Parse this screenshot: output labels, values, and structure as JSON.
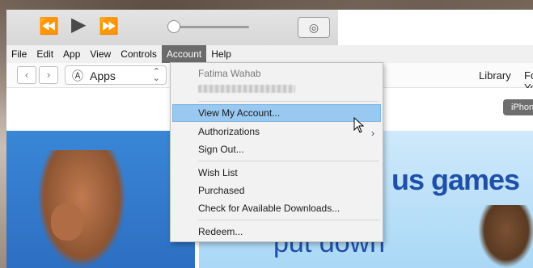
{
  "menubar": {
    "items": [
      "File",
      "Edit",
      "App",
      "View",
      "Controls",
      "Account",
      "Help"
    ],
    "active": "Account"
  },
  "toolbar": {
    "back_glyph": "‹",
    "forward_glyph": "›",
    "media_select_label": "Apps",
    "nav_library": "Library",
    "nav_for_you": "For You"
  },
  "content": {
    "chip_label": "iPhone",
    "banner_title": "us games",
    "banner_subtitle": "put down"
  },
  "account_menu": {
    "user_name": "Fatima Wahab",
    "items": [
      {
        "label": "View My Account...",
        "highlighted": true
      },
      {
        "label": "Authorizations",
        "submenu": true
      },
      {
        "label": "Sign Out..."
      },
      {
        "label": "Wish List"
      },
      {
        "label": "Purchased"
      },
      {
        "label": "Check for Available Downloads..."
      },
      {
        "label": "Redeem..."
      }
    ]
  },
  "icons": {
    "rewind": "rewind-icon",
    "play": "play-icon",
    "fast_forward": "fast-forward-icon",
    "airplay": "airplay-icon",
    "apps": "apps-icon",
    "submenu": "chevron-right-icon",
    "cursor": "mouse-cursor-icon"
  },
  "colors": {
    "menu_active_bg": "#6b6b6b",
    "highlight": "#99c9f0",
    "banner_text": "#1f4fa8"
  }
}
